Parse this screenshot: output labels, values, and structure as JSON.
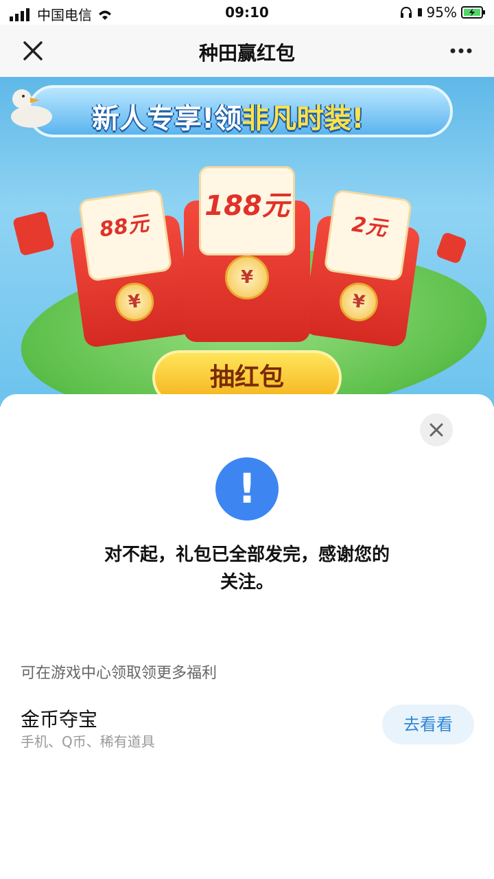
{
  "status": {
    "carrier": "中国电信",
    "time": "09:10",
    "battery": "95%"
  },
  "nav": {
    "title": "种田赢红包"
  },
  "banner": {
    "ribbon_white": "新人专享!领",
    "ribbon_highlight": "非凡时装!",
    "envelopes": [
      {
        "amount": "88元",
        "coin": "¥"
      },
      {
        "amount": "188元",
        "coin": "¥"
      },
      {
        "amount": "2元",
        "coin": "¥"
      }
    ],
    "draw_button": "抽红包"
  },
  "sheet": {
    "alert_symbol": "!",
    "message": "对不起，礼包已全部发完，感谢您的关注。",
    "more_label": "可在游戏中心领取领更多福利",
    "reward_title": "金币夺宝",
    "reward_subtitle": "手机、Q币、稀有道具",
    "go_button": "去看看"
  },
  "colors": {
    "accent_blue": "#3d86f2",
    "button_text": "#2b86d6",
    "button_bg": "#e9f3fb"
  }
}
